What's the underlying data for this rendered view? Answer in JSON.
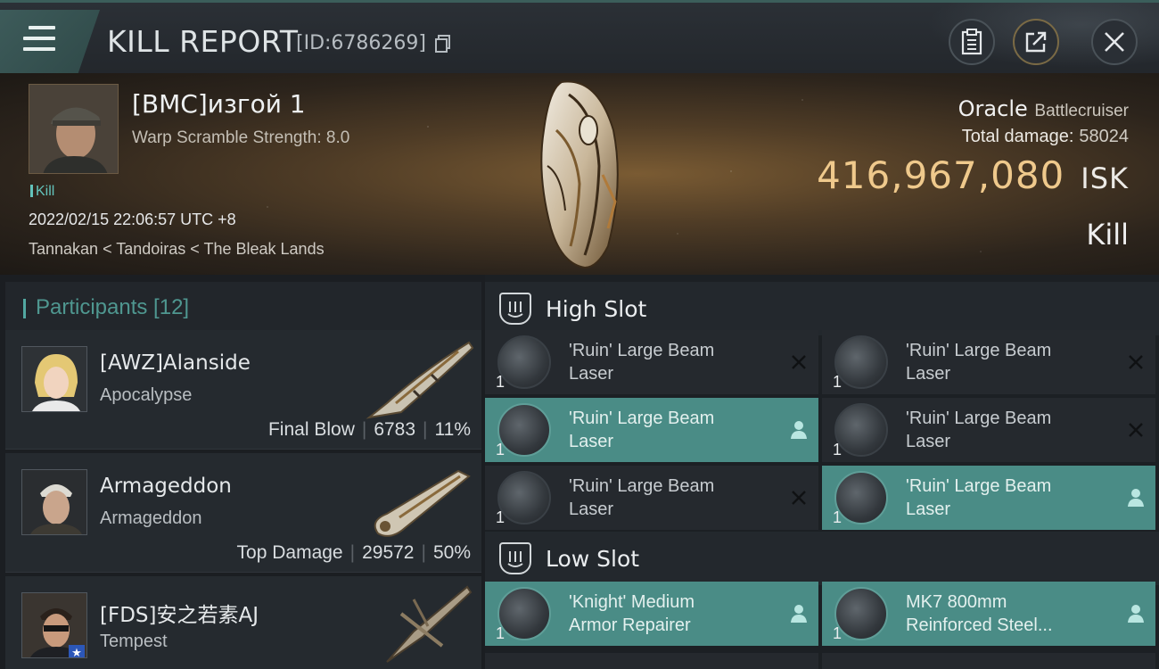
{
  "header": {
    "title": "KILL REPORT",
    "report_id": "[ID:6786269]"
  },
  "victim": {
    "name": "[BMC]изгой 1",
    "warp_scramble": "Warp Scramble Strength: 8.0",
    "tag": "Kill",
    "time": "2022/02/15 22:06:57 UTC +8",
    "location": "Tannakan < Tandoiras < The Bleak Lands"
  },
  "ship": {
    "name": "Oracle",
    "class": "Battlecruiser",
    "total_damage_label": "Total damage:",
    "total_damage": "58024",
    "isk_value": "416,967,080",
    "isk_unit": "ISK",
    "result": "Kill"
  },
  "participants": {
    "label": "Participants [12]",
    "rows": [
      {
        "name": "[AWZ]Alanside",
        "ship": "Apocalypse",
        "role": "Final Blow",
        "damage": "6783",
        "pct": "11%"
      },
      {
        "name": "Armageddon",
        "ship": "Armageddon",
        "role": "Top Damage",
        "damage": "29572",
        "pct": "50%"
      },
      {
        "name": "[FDS]安之若素AJ",
        "ship": "Tempest",
        "role": "",
        "damage": "",
        "pct": ""
      }
    ]
  },
  "fitting": {
    "high_label": "High Slot",
    "low_label": "Low Slot",
    "high": [
      {
        "line1": "'Ruin' Large Beam",
        "line2": "Laser",
        "qty": "1",
        "state": "destroyed"
      },
      {
        "line1": "'Ruin' Large Beam",
        "line2": "Laser",
        "qty": "1",
        "state": "destroyed"
      },
      {
        "line1": "'Ruin' Large Beam",
        "line2": "Laser",
        "qty": "1",
        "state": "dropped"
      },
      {
        "line1": "'Ruin' Large Beam",
        "line2": "Laser",
        "qty": "1",
        "state": "destroyed"
      },
      {
        "line1": "'Ruin' Large Beam",
        "line2": "Laser",
        "qty": "1",
        "state": "destroyed"
      },
      {
        "line1": "'Ruin' Large Beam",
        "line2": "Laser",
        "qty": "1",
        "state": "dropped"
      }
    ],
    "low": [
      {
        "line1": "'Knight' Medium",
        "line2": "Armor Repairer",
        "qty": "1",
        "state": "dropped"
      },
      {
        "line1": "MK7 800mm",
        "line2": "Reinforced Steel...",
        "qty": "1",
        "state": "dropped"
      }
    ]
  },
  "colors": {
    "accent_teal": "#4a8c86",
    "isk_gold": "#efc98c",
    "participants_label": "#4f9790"
  },
  "icons": [
    "menu-icon",
    "copy-icon",
    "clipboard-icon",
    "share-icon",
    "close-icon",
    "slot-icon",
    "pilot-icon",
    "destroyed-x-icon"
  ]
}
